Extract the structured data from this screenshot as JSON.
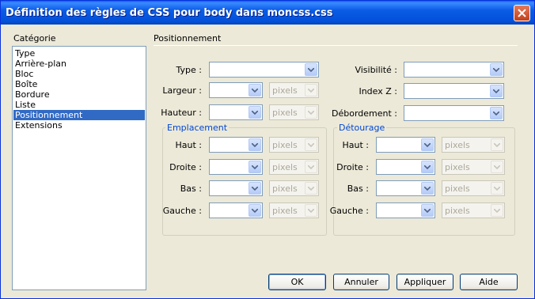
{
  "window": {
    "title": "Définition des règles de CSS pour body dans moncss.css"
  },
  "category": {
    "label": "Catégorie",
    "items": [
      "Type",
      "Arrière-plan",
      "Bloc",
      "Boîte",
      "Bordure",
      "Liste",
      "Positionnement",
      "Extensions"
    ],
    "selected": "Positionnement"
  },
  "section": {
    "title": "Positionnement"
  },
  "fields": {
    "type": {
      "label": "Type :",
      "value": ""
    },
    "largeur": {
      "label": "Largeur :",
      "value": "",
      "unit": "pixels"
    },
    "hauteur": {
      "label": "Hauteur :",
      "value": "",
      "unit": "pixels"
    },
    "visibilite": {
      "label": "Visibilité :",
      "value": ""
    },
    "indexz": {
      "label": "Index Z :",
      "value": ""
    },
    "debordement": {
      "label": "Débordement :",
      "value": ""
    }
  },
  "emplacement": {
    "title": "Emplacement",
    "haut": {
      "label": "Haut :",
      "value": "",
      "unit": "pixels"
    },
    "droite": {
      "label": "Droite :",
      "value": "",
      "unit": "pixels"
    },
    "bas": {
      "label": "Bas :",
      "value": "",
      "unit": "pixels"
    },
    "gauche": {
      "label": "Gauche :",
      "value": "",
      "unit": "pixels"
    }
  },
  "detourage": {
    "title": "Détourage",
    "haut": {
      "label": "Haut :",
      "value": "",
      "unit": "pixels"
    },
    "droite": {
      "label": "Droite :",
      "value": "",
      "unit": "pixels"
    },
    "bas": {
      "label": "Bas :",
      "value": "",
      "unit": "pixels"
    },
    "gauche": {
      "label": "Gauche :",
      "value": "",
      "unit": "pixels"
    }
  },
  "buttons": {
    "ok": "OK",
    "cancel": "Annuler",
    "apply": "Appliquer",
    "help": "Aide"
  },
  "icons": {
    "close": "close-icon",
    "dropdown": "chevron-down-icon"
  },
  "colors": {
    "titlebar": "#0A5CE6",
    "selection": "#316AC5",
    "group_title": "#0046D5",
    "dialog_bg": "#ECE9D8"
  }
}
